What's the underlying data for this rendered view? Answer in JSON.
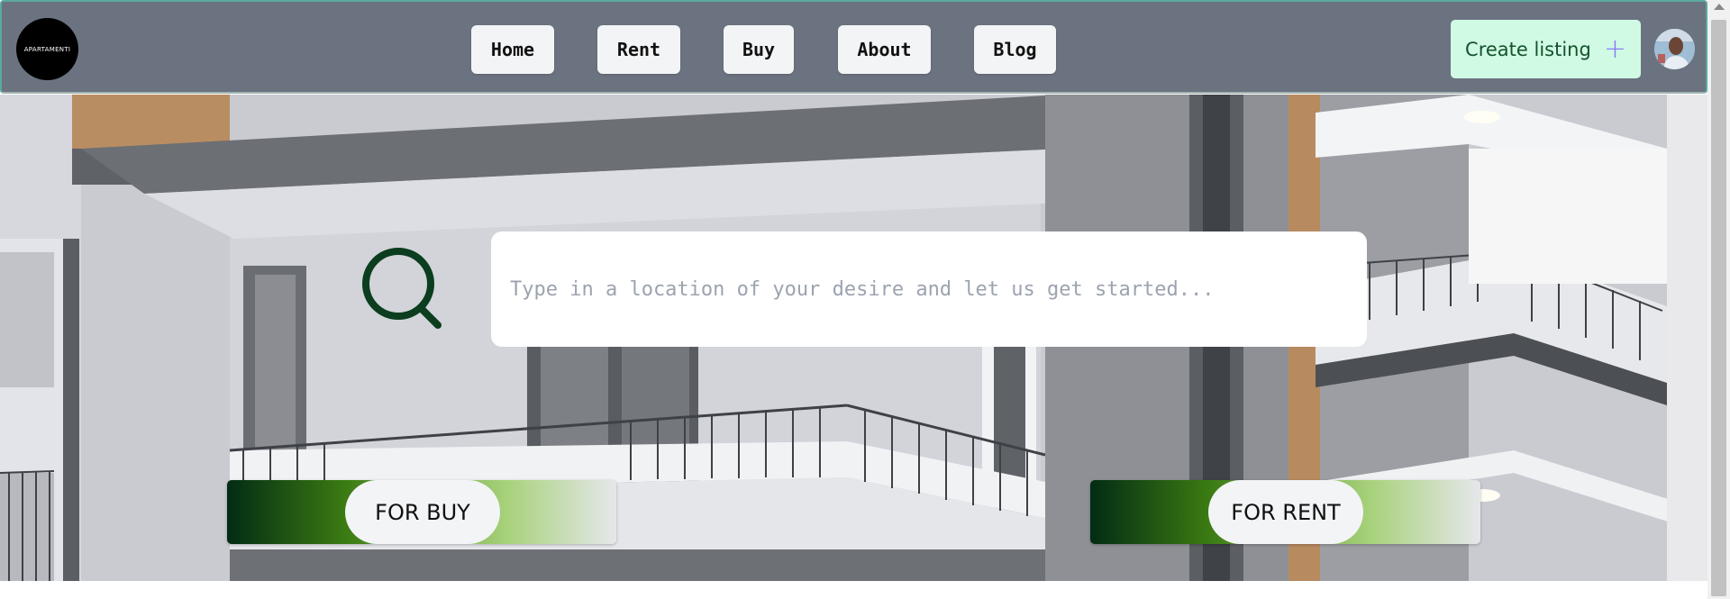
{
  "header": {
    "logo_text": "APARTAMENTI",
    "nav": [
      {
        "label": "Home"
      },
      {
        "label": "Rent"
      },
      {
        "label": "Buy"
      },
      {
        "label": "About"
      },
      {
        "label": "Blog"
      }
    ],
    "create_label": "Create listing",
    "create_icon": "plus-icon"
  },
  "hero": {
    "search_placeholder": "Type in a location of your desire and let us get started...",
    "search_icon": "search-icon",
    "buy_label": "FOR BUY",
    "rent_label": "FOR RENT"
  },
  "colors": {
    "header_bg": "#6b7280",
    "create_bg": "#d1fae5",
    "create_text": "#14532d",
    "search_icon": "#0b3d1e",
    "gradient_dark": "#022c14",
    "gradient_mid": "#3a7a12",
    "gradient_light": "#a8d27c"
  }
}
